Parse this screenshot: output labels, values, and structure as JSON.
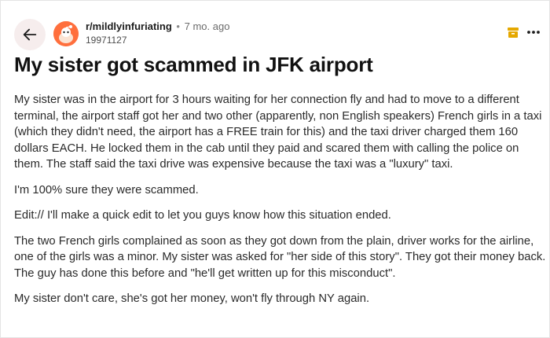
{
  "post": {
    "subreddit": "r/mildlyinfuriating",
    "separator": "•",
    "time_ago": "7 mo. ago",
    "author": "19971127",
    "title": "My sister got scammed in JFK airport",
    "paragraphs": [
      [
        "My sister was in the airport for 3 hours waiting for her connection fly and had to move to a different",
        "terminal, the airport staff got her and two other (apparently, non English speakers) French girls in a taxi",
        "(which they didn't need, the airport has a FREE train for this) and the taxi driver charged them 160",
        "dollars EACH. He locked them in the cab until they paid and scared them with calling the police on",
        "them. The staff said the taxi drive was expensive because the taxi was a \"luxury\" taxi."
      ],
      [
        "I'm 100% sure they were scammed."
      ],
      [
        "Edit:// I'll make a quick edit to let you guys know how this situation ended."
      ],
      [
        "The two French girls complained as soon as they got down from the plain, driver works for the airline,",
        "one of the girls was a minor. My sister was asked for \"her side of this story\". They got their money back.",
        "The guy has done this before and \"he'll get written up for this misconduct\"."
      ],
      [
        "My sister don't care, she's got her money, won't fly through NY again."
      ]
    ]
  },
  "icons": {
    "back": "arrow-left-icon",
    "avatar": "subreddit-avatar",
    "archived": "archive-box-icon",
    "more": "more-horizontal-icon"
  },
  "colors": {
    "back_button_bg": "#f6eded",
    "avatar_bg": "#ff6f3d",
    "archived_icon": "#e5a800"
  }
}
